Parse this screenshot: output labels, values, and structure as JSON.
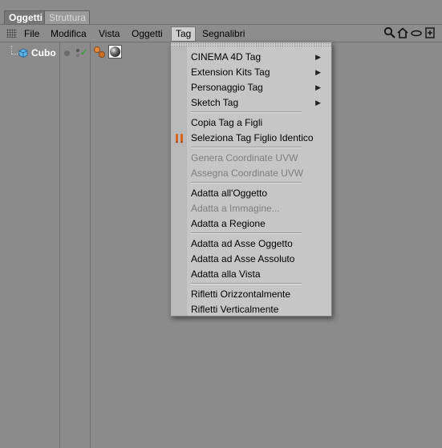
{
  "tabs": {
    "active": "Oggetti",
    "inactive": "Struttura"
  },
  "menubar": {
    "items": [
      "File",
      "Modifica",
      "Vista",
      "Oggetti",
      "Tag",
      "Segnalibri"
    ],
    "open_item": "Tag"
  },
  "toolbar_icons": [
    "search-icon",
    "home-icon",
    "view-icon",
    "new-window-icon"
  ],
  "objects": [
    {
      "name": "Cubo",
      "enabled": true
    }
  ],
  "tag_menu": {
    "submenus": [
      "CINEMA 4D Tag",
      "Extension Kits Tag",
      "Personaggio Tag",
      "Sketch Tag"
    ],
    "group2": [
      "Copia Tag a Figli",
      "Seleziona Tag Figlio Identico"
    ],
    "group3_disabled": [
      "Genera Coordinate UVW",
      "Assegna Coordinate UVW"
    ],
    "group4": {
      "fit_object": "Adatta all'Oggetto",
      "fit_image": "Adatta a Immagine...",
      "fit_region": "Adatta a Regione"
    },
    "group5": [
      "Adatta ad Asse Oggetto",
      "Adatta ad Asse Assoluto",
      "Adatta alla Vista"
    ],
    "group6": [
      "Rifletti Orizzontalmente",
      "Rifletti Verticalmente"
    ]
  },
  "colors": {
    "panel_bg": "#8b8b8b",
    "menu_bg": "#c6c6c6",
    "check_green": "#2f9b2f",
    "object_label": "#ffffff"
  }
}
